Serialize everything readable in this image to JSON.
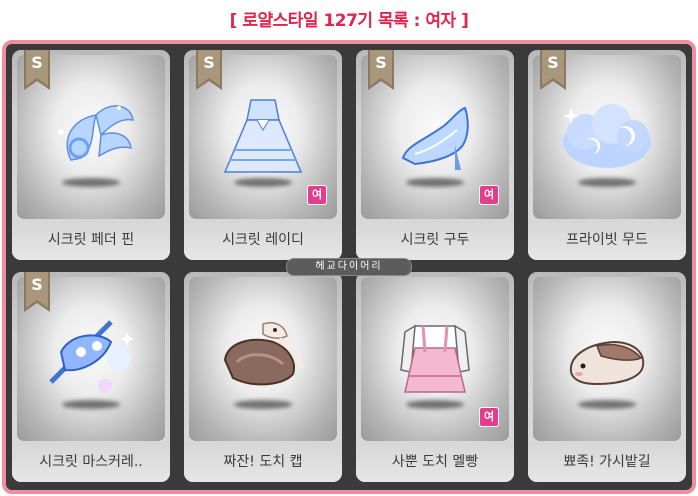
{
  "title": "[ 로얄스타일 127기 목록 : 여자 ]",
  "watermark": "헤교다이어리",
  "colors": {
    "title": "#e2244a",
    "frame": "#ee8fa0",
    "panel": "#3a3a3a",
    "gender_badge": "#e63c8c"
  },
  "items": [
    {
      "name": "시크릿 페더 핀",
      "grade": "S",
      "gender": "",
      "icon": "feather-pin-icon"
    },
    {
      "name": "시크릿 레이디",
      "grade": "S",
      "gender": "여",
      "icon": "dress-icon"
    },
    {
      "name": "시크릿 구두",
      "grade": "S",
      "gender": "여",
      "icon": "glass-shoe-icon"
    },
    {
      "name": "프라이빗 무드",
      "grade": "S",
      "gender": "",
      "icon": "cloud-moon-icon"
    },
    {
      "name": "시크릿 마스커레..",
      "grade": "S",
      "gender": "",
      "icon": "masquerade-icon"
    },
    {
      "name": "짜잔! 도치 캡",
      "grade": "",
      "gender": "",
      "icon": "hedgehog-cap-icon"
    },
    {
      "name": "사뿐 도치 멜빵",
      "grade": "",
      "gender": "여",
      "icon": "overalls-icon"
    },
    {
      "name": "뾰족! 가시밭길",
      "grade": "",
      "gender": "",
      "icon": "hedgehog-shoe-icon"
    }
  ]
}
